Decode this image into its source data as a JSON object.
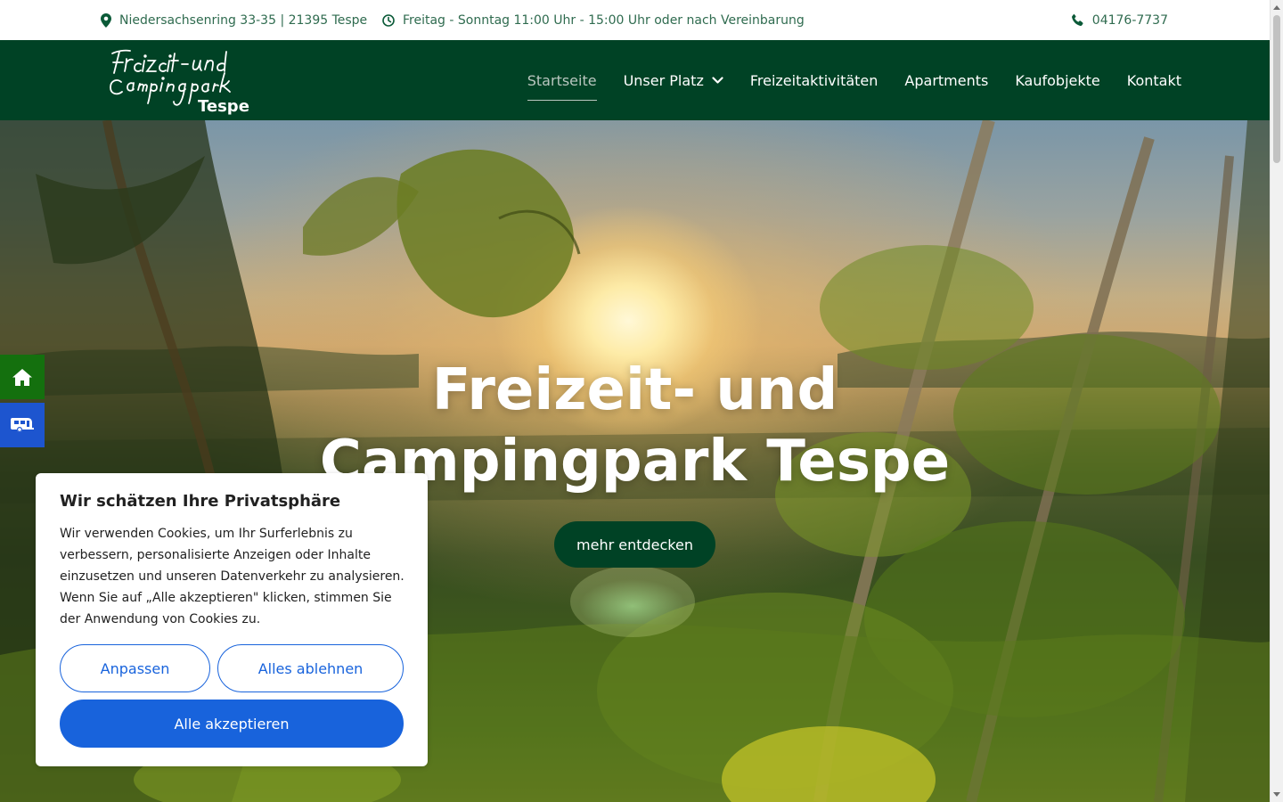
{
  "topbar": {
    "address": "Niedersachsenring 33-35 | 21395 Tespe",
    "hours": "Freitag - Sonntag 11:00 Uhr - 15:00 Uhr oder nach Vereinbarung",
    "phone": "04176-7737",
    "icons": [
      "location-pin-icon",
      "clock-icon",
      "phone-icon"
    ]
  },
  "logo": {
    "line1": "Freizeit- und",
    "line2": "Campingpark",
    "line3": "Tespe"
  },
  "nav": {
    "items": [
      {
        "label": "Startseite",
        "active": true
      },
      {
        "label": "Unser Platz",
        "has_dropdown": true
      },
      {
        "label": "Freizeitaktivitäten"
      },
      {
        "label": "Apartments"
      },
      {
        "label": "Kaufobjekte"
      },
      {
        "label": "Kontakt"
      }
    ]
  },
  "hero": {
    "title_line1": "Freizeit- und",
    "title_line2": "Campingpark Tespe",
    "button_label": "mehr entdecken"
  },
  "side_buttons": [
    {
      "icon": "home-icon"
    },
    {
      "icon": "camper-icon"
    }
  ],
  "cookie": {
    "title": "Wir schätzen Ihre Privatsphäre",
    "text": "Wir verwenden Cookies, um Ihr Surferlebnis zu verbessern, personalisierte Anzeigen oder Inhalte einzusetzen und unseren Datenverkehr zu analysieren. Wenn Sie auf „Alle akzeptieren\" klicken, stimmen Sie der Anwendung von Cookies zu.",
    "btn_customize": "Anpassen",
    "btn_reject": "Alles ablehnen",
    "btn_accept": "Alle akzeptieren"
  },
  "colors": {
    "brand_green": "#004225",
    "accent_blue": "#1863dc",
    "side_home_green": "#14700e",
    "side_camper_blue": "#1d55cf",
    "topbar_text": "#2f6b4f"
  }
}
